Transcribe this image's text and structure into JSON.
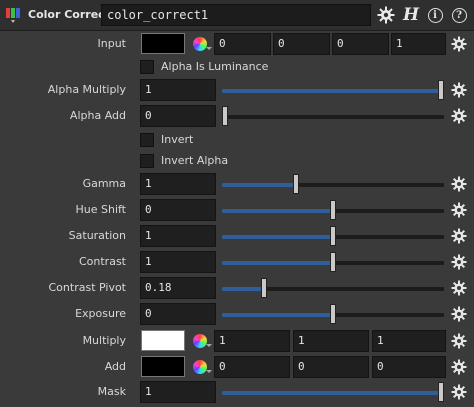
{
  "header": {
    "node_type": "Color Correct",
    "node_name": "color_correct1",
    "gear_icon": "gear-icon",
    "houdini_icon": "H",
    "info_icon": "i",
    "help_icon": "?"
  },
  "params": {
    "input": {
      "label": "Input",
      "color": "#000000",
      "values": [
        "0",
        "0",
        "0",
        "1"
      ]
    },
    "alpha_is_luminance": {
      "label": "Alpha Is Luminance",
      "checked": false
    },
    "alpha_multiply": {
      "label": "Alpha Multiply",
      "value": "1",
      "level": 1.0
    },
    "alpha_add": {
      "label": "Alpha Add",
      "value": "0",
      "level": 0.0
    },
    "invert": {
      "label": "Invert",
      "checked": false
    },
    "invert_alpha": {
      "label": "Invert Alpha",
      "checked": false
    },
    "gamma": {
      "label": "Gamma",
      "value": "1",
      "level": 0.33
    },
    "hue_shift": {
      "label": "Hue Shift",
      "value": "0",
      "level": 0.5
    },
    "saturation": {
      "label": "Saturation",
      "value": "1",
      "level": 0.5
    },
    "contrast": {
      "label": "Contrast",
      "value": "1",
      "level": 0.5
    },
    "contrast_pivot": {
      "label": "Contrast Pivot",
      "value": "0.18",
      "level": 0.18
    },
    "exposure": {
      "label": "Exposure",
      "value": "0",
      "level": 0.5
    },
    "multiply": {
      "label": "Multiply",
      "color": "#ffffff",
      "values": [
        "1",
        "1",
        "1"
      ]
    },
    "add": {
      "label": "Add",
      "color": "#000000",
      "values": [
        "0",
        "0",
        "0"
      ]
    },
    "mask": {
      "label": "Mask",
      "value": "1",
      "level": 1.0
    }
  },
  "colors": {
    "slider_fill": "#2f5e9a",
    "background": "#3a3a3a"
  }
}
